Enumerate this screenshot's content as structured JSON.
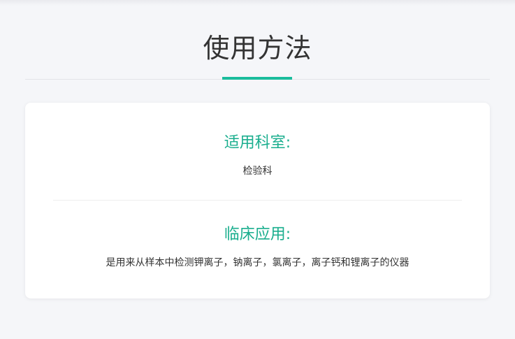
{
  "page": {
    "title": "使用方法"
  },
  "sections": [
    {
      "heading": "适用科室:",
      "text": "检验科"
    },
    {
      "heading": "临床应用:",
      "text": "是用来从样本中检测钾离子，钠离子，氯离子，离子钙和锂离子的仪器"
    }
  ],
  "colors": {
    "accent": "#1abc9c",
    "heading_text": "#1aae8e",
    "background": "#f5f6f9"
  }
}
